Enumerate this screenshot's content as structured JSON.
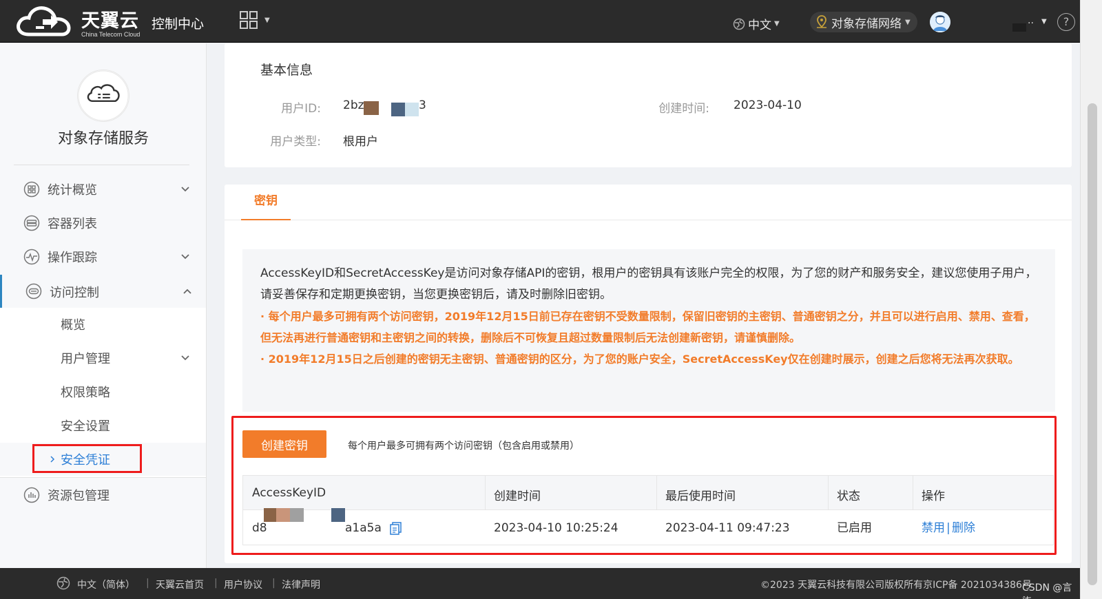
{
  "header": {
    "brand": "天翼云",
    "brand_en": "China Telecom Cloud",
    "console": "控制中心",
    "language": "中文",
    "region": "对象存储网络",
    "user_suffix": "..",
    "help": "?"
  },
  "sidebar": {
    "service_title": "对象存储服务",
    "items": [
      {
        "label": "统计概览",
        "icon": "dashboard-icon"
      },
      {
        "label": "容器列表",
        "icon": "bucket-icon"
      },
      {
        "label": "操作跟踪",
        "icon": "trace-icon"
      },
      {
        "label": "访问控制",
        "icon": "access-icon"
      },
      {
        "label": "资源包管理",
        "icon": "package-icon"
      }
    ],
    "sub_items": [
      "概览",
      "用户管理",
      "权限策略",
      "安全设置",
      "安全凭证"
    ]
  },
  "basic_info": {
    "title": "基本信息",
    "user_id_label": "用户ID:",
    "user_id_start": "2bz",
    "user_id_end": "3",
    "created_label": "创建时间:",
    "created_value": "2023-04-10",
    "user_type_label": "用户类型:",
    "user_type_value": "根用户"
  },
  "keys": {
    "tab": "密钥",
    "notice_line1": "AccessKeyID和SecretAccessKey是访问对象存储API的密钥，根用户的密钥具有该账户完全的权限，为了您的财产和服务安全，建议您使用子用户，请妥善保存和定期更换密钥，当您更换密钥后，请及时删除旧密钥。",
    "notice_line2": "· 每个用户最多可拥有两个访问密钥，2019年12月15日前已存在密钥不受数量限制，保留旧密钥的主密钥、普通密钥之分，并且可以进行启用、禁用、查看，但无法再进行普通密钥和主密钥之间的转换，删除后不可恢复且超过数量限制后无法创建新密钥，请谨慎删除。",
    "notice_line3": "· 2019年12月15日之后创建的密钥无主密钥、普通密钥的区分，为了您的账户安全，SecretAccessKey仅在创建时展示，创建之后您将无法再次获取。",
    "create_button": "创建密钥",
    "create_hint": "每个用户最多可拥有两个访问密钥（包含启用或禁用）",
    "table": {
      "headers": [
        "AccessKeyID",
        "创建时间",
        "最后使用时间",
        "状态",
        "操作"
      ],
      "rows": [
        {
          "key_start": "d8",
          "key_end": "a1a5a",
          "created": "2023-04-10 10:25:24",
          "last_used": "2023-04-11 09:47:23",
          "status": "已启用",
          "action_disable": "禁用",
          "action_sep": "|",
          "action_delete": "删除"
        }
      ]
    }
  },
  "footer": {
    "language": "中文（简体）",
    "links": [
      "天翼云首页",
      "用户协议",
      "法律声明"
    ],
    "copyright": "©2023 天翼云科技有限公司版权所有京ICP备 2021034386号",
    "watermark": "CSDN @言 柒"
  },
  "colors": {
    "accent": "#f27c2a",
    "link": "#2d7fd6",
    "highlight": "#ee1c1c",
    "topbar": "#2b2b2b"
  }
}
